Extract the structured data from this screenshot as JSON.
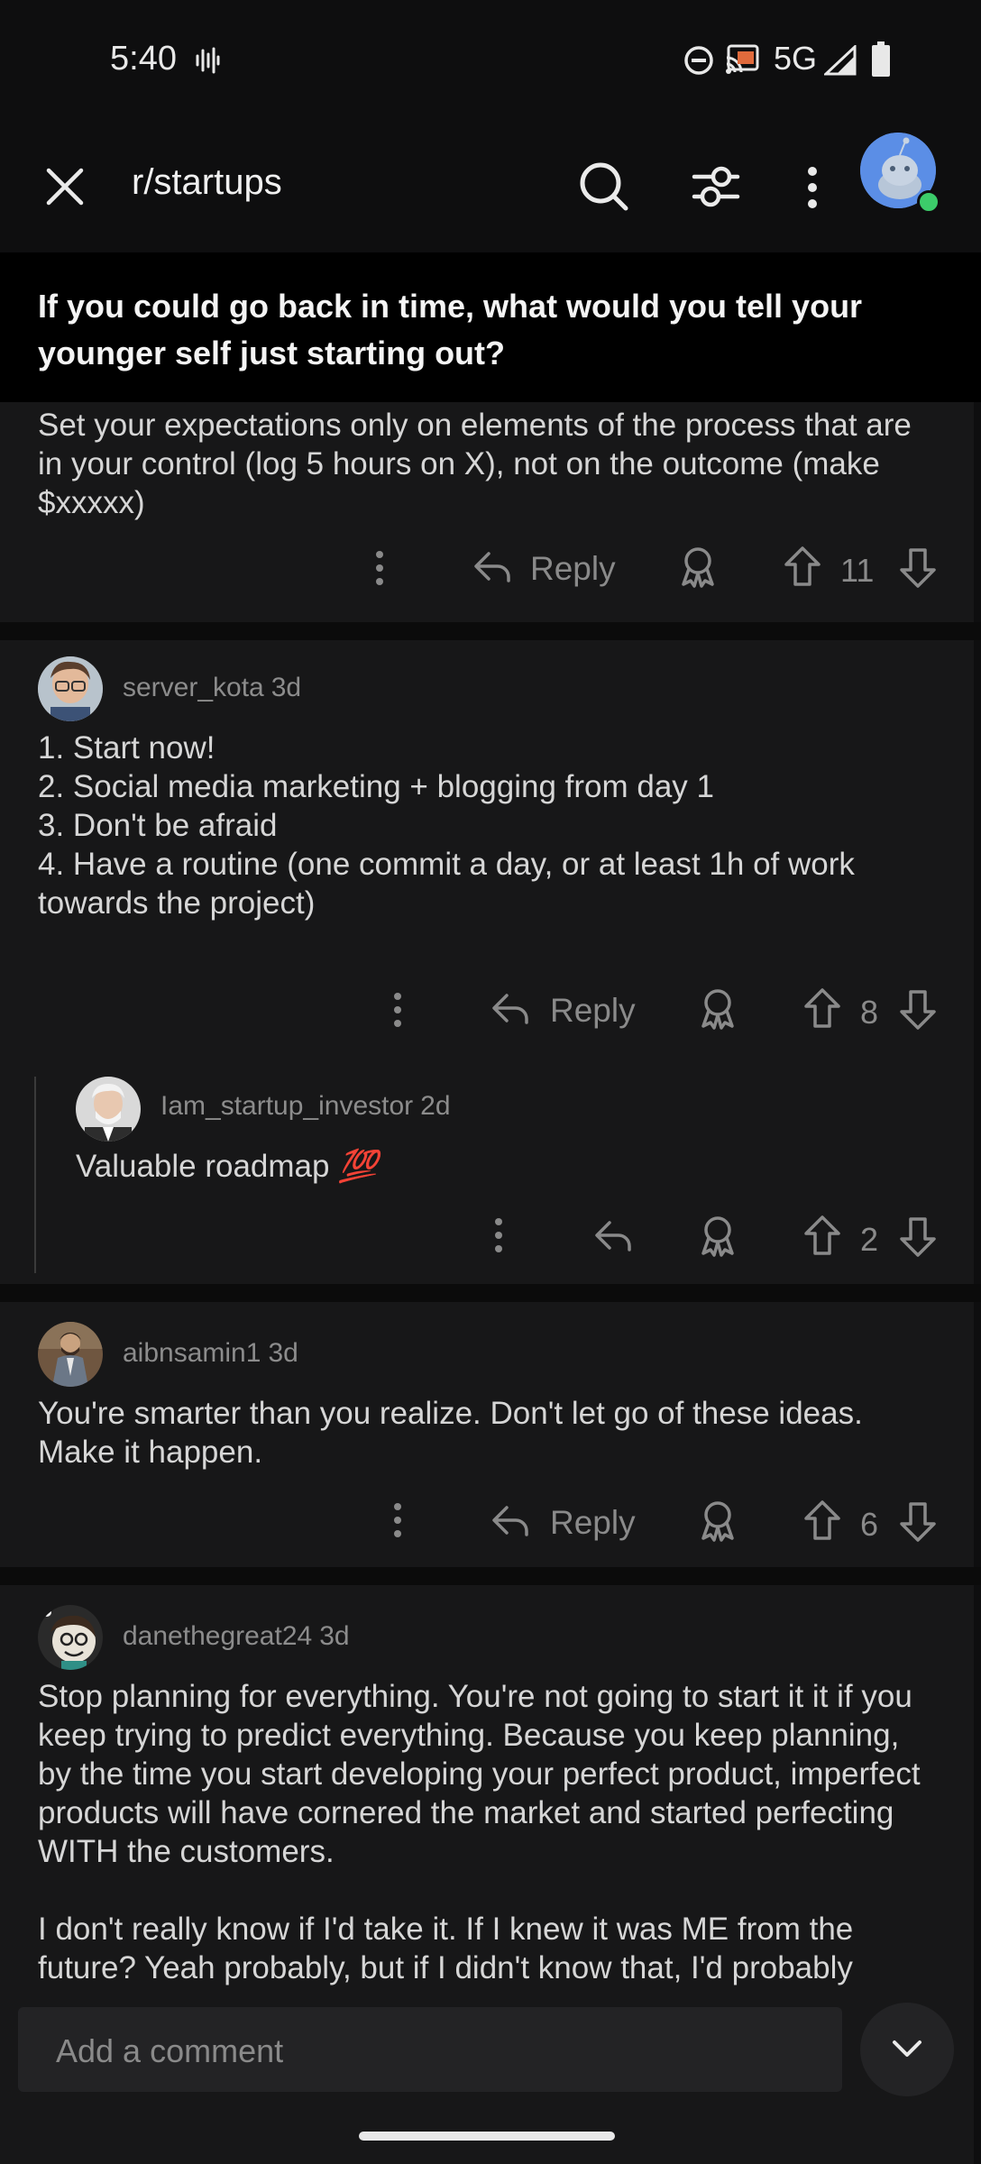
{
  "status_bar": {
    "time": "5:40",
    "network": "5G"
  },
  "header": {
    "subreddit": "r/startups"
  },
  "post": {
    "title": "If you could go back in time, what would you tell your younger self just starting out?"
  },
  "comments": [
    {
      "body": "Set your expectations only on elements of the process that are in your control (log 5 hours on X), not on the outcome (make $xxxxx)",
      "reply_label": "Reply",
      "score": "11"
    },
    {
      "author": "server_kota",
      "age": "3d",
      "body_lines": [
        "1. Start now!",
        "2. Social media marketing + blogging from day 1",
        "3. Don't be afraid",
        "4. Have a routine (one commit a day, or at least 1h of work towards the project)"
      ],
      "reply_label": "Reply",
      "score": "8",
      "replies": [
        {
          "author": "Iam_startup_investor",
          "age": "2d",
          "body": "Valuable roadmap",
          "emoji": "💯",
          "score": "2"
        }
      ]
    },
    {
      "author": "aibnsamin1",
      "age": "3d",
      "body": "You're smarter than you realize. Don't let go of these ideas. Make it happen.",
      "reply_label": "Reply",
      "score": "6"
    },
    {
      "author": "danethegreat24",
      "age": "3d",
      "body_paragraph_1": "Stop planning for everything. You're not going to start it it if you keep trying to predict everything. Because you keep planning, by the time you start developing your perfect product, imperfect products will have cornered the market and started perfecting WITH the customers.",
      "body_paragraph_2": "I don't really know if I'd take it. If I knew it was ME from the future? Yeah probably, but if I didn't know that, I'd probably"
    }
  ],
  "composer": {
    "placeholder": "Add a comment"
  },
  "colors": {
    "background": "#0e0e0f",
    "comment_bg": "#171718",
    "title_bar_bg": "#000000",
    "avatar_blue": "#5b8ee6",
    "online_green": "#3ccc6a"
  }
}
